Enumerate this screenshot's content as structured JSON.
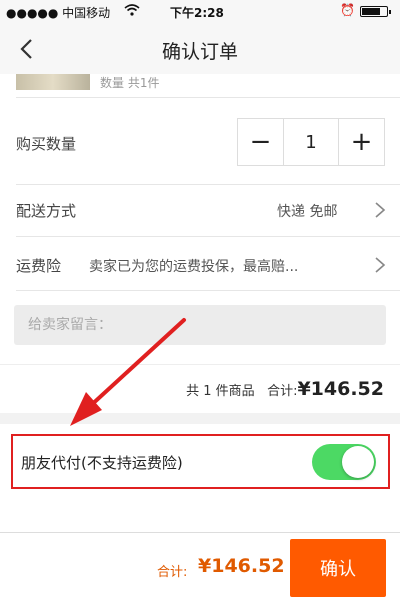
{
  "status_bar": {
    "carrier": "●●●●● 中国移动",
    "time": "下午2:28"
  },
  "nav": {
    "title": "确认订单"
  },
  "product": {
    "cut_text": "数量 共1件"
  },
  "quantity": {
    "label": "购买数量",
    "minus": "−",
    "value": "1",
    "plus": "+"
  },
  "delivery": {
    "label": "配送方式",
    "value": "快递 免邮"
  },
  "insurance": {
    "label": "运费险",
    "value": "卖家已为您的运费投保，最高赔..."
  },
  "message": {
    "placeholder": "给卖家留言："
  },
  "summary": {
    "count_text": "共 1 件商品",
    "total_label": "合计:",
    "total": "¥146.52"
  },
  "friend_pay": {
    "label": "朋友代付(不支持运费险)",
    "enabled": true
  },
  "bottom": {
    "total_label": "合计:",
    "total": "¥146.52",
    "confirm": "确认"
  },
  "colors": {
    "accent": "#ff5a00",
    "toggle_on": "#4cd964",
    "highlight": "#e02020"
  }
}
